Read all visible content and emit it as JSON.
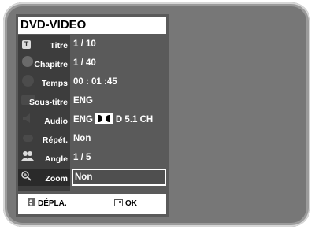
{
  "menu": {
    "title": "DVD-VIDEO",
    "rows": [
      {
        "label": "Titre",
        "value": "1 / 10",
        "icon": "title-icon"
      },
      {
        "label": "Chapitre",
        "value": "1 / 40",
        "icon": "disc-icon"
      },
      {
        "label": "Temps",
        "value": "00 : 01 :45",
        "icon": "clock-icon"
      },
      {
        "label": "Sous-titre",
        "value": "ENG",
        "icon": "subtitle-icon"
      },
      {
        "label": "Audio",
        "value_lang": "ENG",
        "value_format": "D 5.1 CH",
        "icon": "speaker-icon"
      },
      {
        "label": "Répét.",
        "value": "Non",
        "icon": "repeat-icon"
      },
      {
        "label": "Angle",
        "value": "1 / 5",
        "icon": "angle-icon"
      },
      {
        "label": "Zoom",
        "value": "Non",
        "icon": "zoom-icon",
        "selected": true
      }
    ]
  },
  "footer": {
    "move_label": "DÉPLA.",
    "ok_label": "OK"
  },
  "colors": {
    "screen": "#777777",
    "panel": "#5a5a5a",
    "label_column": "#3d3d3d",
    "text": "#ffffff",
    "title_bar": "#ffffff"
  }
}
